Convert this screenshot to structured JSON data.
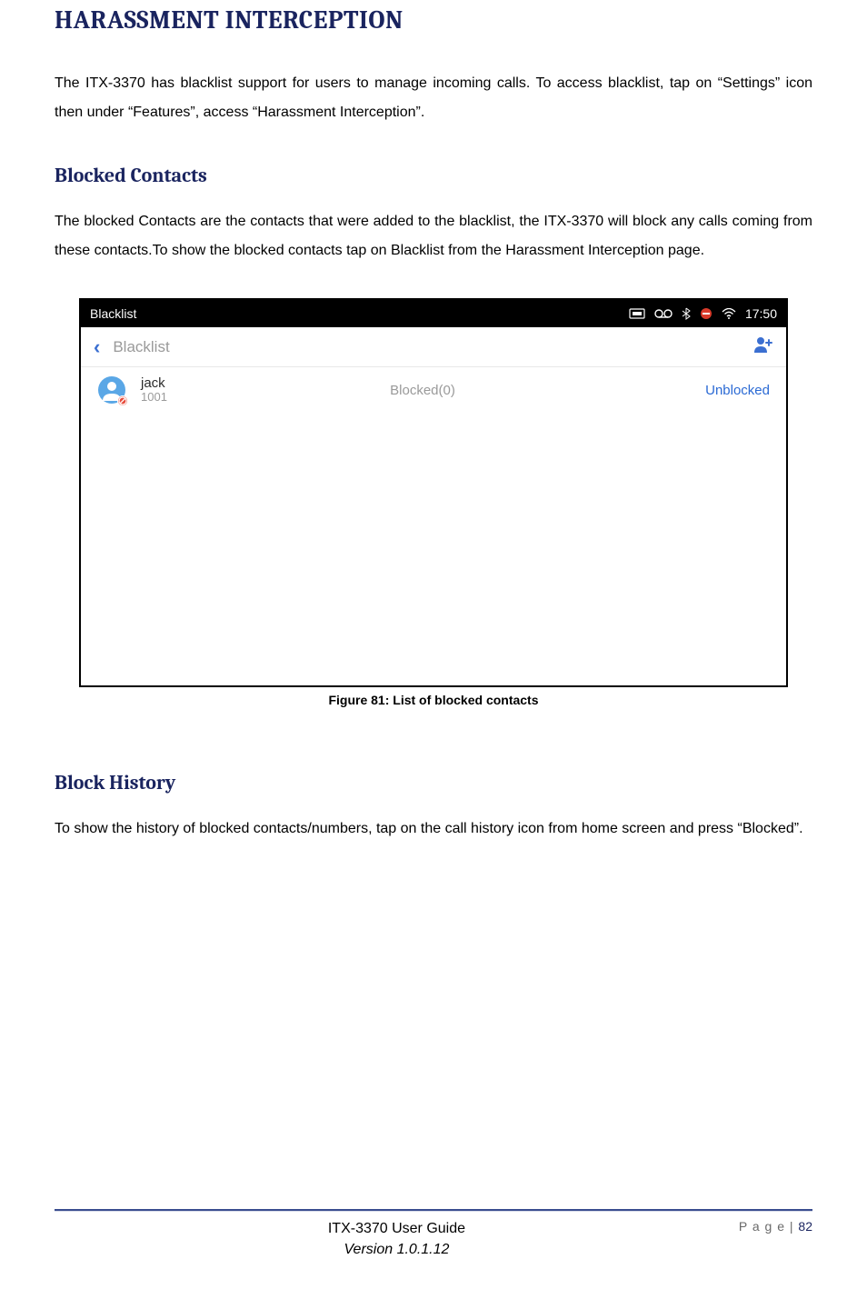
{
  "h1": "HARASSMENT INTERCEPTION",
  "intro": "The ITX-3370 has blacklist support for users to manage incoming calls. To access blacklist, tap on “Settings” icon then under “Features”, access “Harassment Interception”.",
  "section1": {
    "heading": "Blocked Contacts",
    "para": "The blocked Contacts are the contacts that were added to the blacklist, the ITX-3370 will block any calls coming from these contacts.To show the blocked contacts tap on Blacklist from the Harassment Interception page."
  },
  "screenshot": {
    "appTitle": "Blacklist",
    "time": "17:50",
    "subTitle": "Blacklist",
    "contact": {
      "name": "jack",
      "number": "1001"
    },
    "blockedLabel": "Blocked(0)",
    "unblockedLabel": "Unblocked"
  },
  "caption": "Figure 81: List of blocked contacts",
  "section2": {
    "heading": "Block History",
    "para": "To show the history of blocked contacts/numbers, tap on the call history icon from home screen and press “Blocked”."
  },
  "footer": {
    "title": "ITX-3370 User Guide",
    "version": "Version 1.0.1.12",
    "pageLabel": "P a g e | ",
    "pageNum": "82"
  }
}
